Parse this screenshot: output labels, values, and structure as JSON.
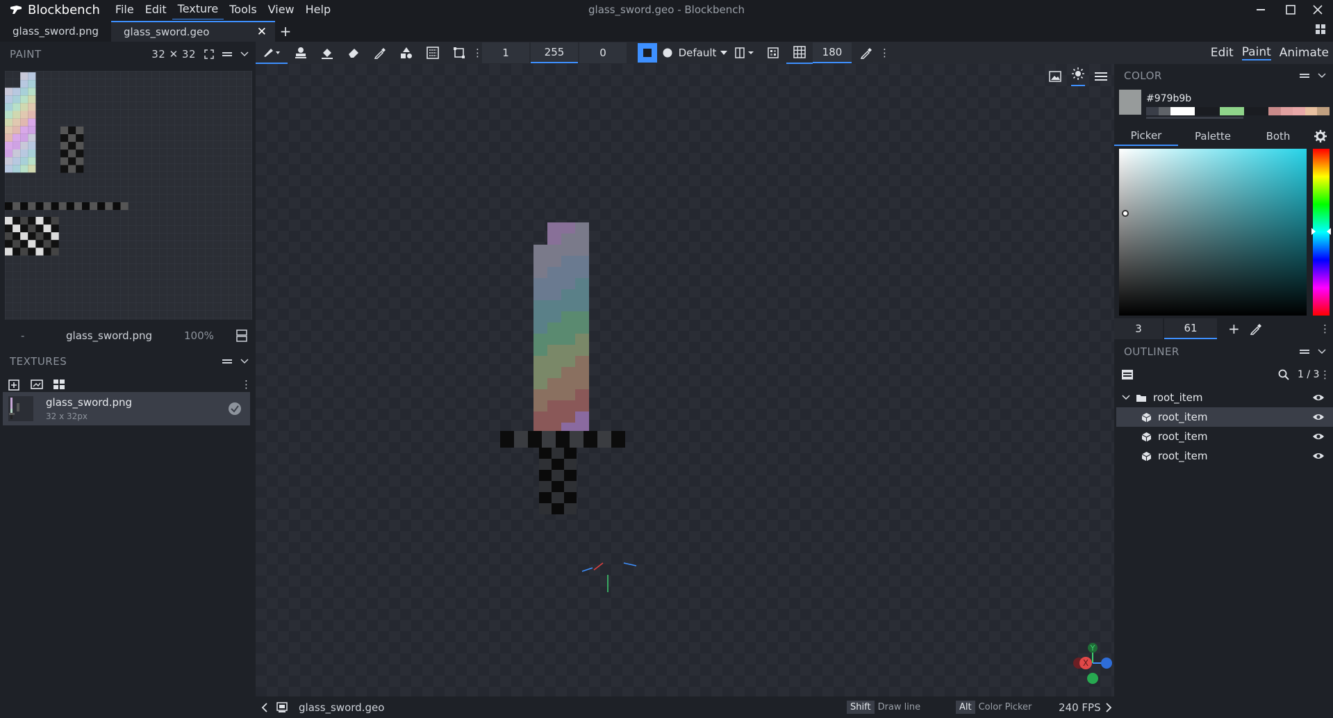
{
  "app": {
    "name": "Blockbench",
    "window_title": "glass_sword.geo - Blockbench",
    "menu": [
      "File",
      "Edit",
      "Texture",
      "Tools",
      "View",
      "Help"
    ],
    "active_menu": "Texture"
  },
  "tabs": [
    {
      "label": "glass_sword.png",
      "selected": false
    },
    {
      "label": "glass_sword.geo",
      "selected": true
    }
  ],
  "toolbar": {
    "brush_size": "1",
    "opacity": "255",
    "softness": "0",
    "blend_mode": "Default",
    "grid_value": "180"
  },
  "modes": {
    "edit": "Edit",
    "paint": "Paint",
    "animate": "Animate",
    "active": "Paint"
  },
  "paint_panel": {
    "title": "PAINT",
    "resolution": "32 ✕ 32",
    "texture_name": "glass_sword.png",
    "zoom": "100%",
    "left_marker": "-"
  },
  "textures_panel": {
    "title": "TEXTURES",
    "items": [
      {
        "name": "glass_sword.png",
        "size": "32 x 32px"
      }
    ]
  },
  "color_panel": {
    "title": "COLOR",
    "hex": "#979b9b",
    "tabs": [
      "Picker",
      "Palette",
      "Both"
    ],
    "active_tab": "Picker",
    "hue_value": "3",
    "saturation_value": "61",
    "main_color": "#979b9b",
    "swatches": [
      "#3a3e48",
      "#5f6368",
      "#ffffff",
      "#ffffff",
      "#1a1c21",
      "#1a1c21",
      "#8fd48a",
      "#8fd48a",
      "#1a1c21",
      "#1a1c21",
      "#c98a8a",
      "#e0a0a0",
      "#e8a8a8",
      "#e8c0a0",
      "#c0a080"
    ]
  },
  "outliner_panel": {
    "title": "OUTLINER",
    "counter": "1 / 3",
    "group": "root_item",
    "items": [
      "root_item",
      "root_item",
      "root_item"
    ],
    "selected_index": 0
  },
  "viewport": {
    "file": "glass_sword.geo",
    "hint1_key": "Shift",
    "hint1_text": "Draw line",
    "hint2_key": "Alt",
    "hint2_text": "Color Picker",
    "fps": "240 FPS",
    "gizmo": {
      "x": "X",
      "y": "Y"
    }
  },
  "colors": {
    "accent": "#3e90ff"
  }
}
